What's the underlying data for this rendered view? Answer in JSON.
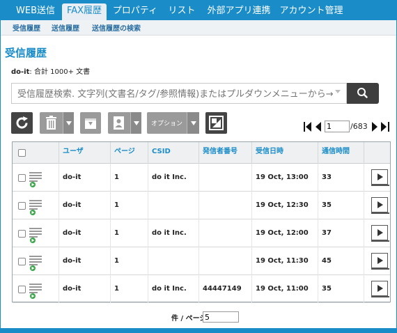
{
  "nav": {
    "tabs": [
      {
        "label": "WEB送信"
      },
      {
        "label": "FAX履歴"
      },
      {
        "label": "プロパティ"
      },
      {
        "label": "リスト"
      },
      {
        "label": "外部アプリ連携"
      },
      {
        "label": "アカウント管理"
      }
    ],
    "active_tab": "FAX履歴"
  },
  "subnav": {
    "items": [
      {
        "label": "受信履歴"
      },
      {
        "label": "送信履歴"
      },
      {
        "label": "送信履歴の検索"
      }
    ]
  },
  "page": {
    "title": "受信履歴",
    "account": "do-it",
    "summary_rest": ": 合計 1000+ 文書"
  },
  "search": {
    "placeholder": "受信履歴検索. 文字列(文書名/タグ/参照情報)またはプルダウンメニューから→"
  },
  "toolbar": {
    "options_label": "オプション"
  },
  "pager": {
    "current": "1",
    "total": "/683"
  },
  "table": {
    "columns": [
      "ユーザ",
      "ページ",
      "CSID",
      "発信者番号",
      "受信日時",
      "通信時間"
    ],
    "rows": [
      {
        "user": "do-it",
        "pages": "1",
        "csid": "do it Inc.",
        "caller": "",
        "received": "19 Oct, 13:00",
        "duration": "33"
      },
      {
        "user": "do-it",
        "pages": "1",
        "csid": "",
        "caller": "",
        "received": "19 Oct, 12:30",
        "duration": "35"
      },
      {
        "user": "do-it",
        "pages": "1",
        "csid": "do it Inc.",
        "caller": "",
        "received": "19 Oct, 12:00",
        "duration": "37"
      },
      {
        "user": "do-it",
        "pages": "1",
        "csid": "",
        "caller": "",
        "received": "19 Oct, 11:30",
        "duration": "45"
      },
      {
        "user": "do-it",
        "pages": "1",
        "csid": "do it Inc.",
        "caller": "44447149",
        "received": "19 Oct, 11:00",
        "duration": "35"
      }
    ]
  },
  "per_page": {
    "label": "件 / ページ",
    "value": "5"
  },
  "colors": {
    "accent": "#1a8cc8",
    "toolbar_dark": "#444444",
    "toolbar_gray": "#9a9a9a",
    "fax_icon_green": "#3aa64a"
  }
}
